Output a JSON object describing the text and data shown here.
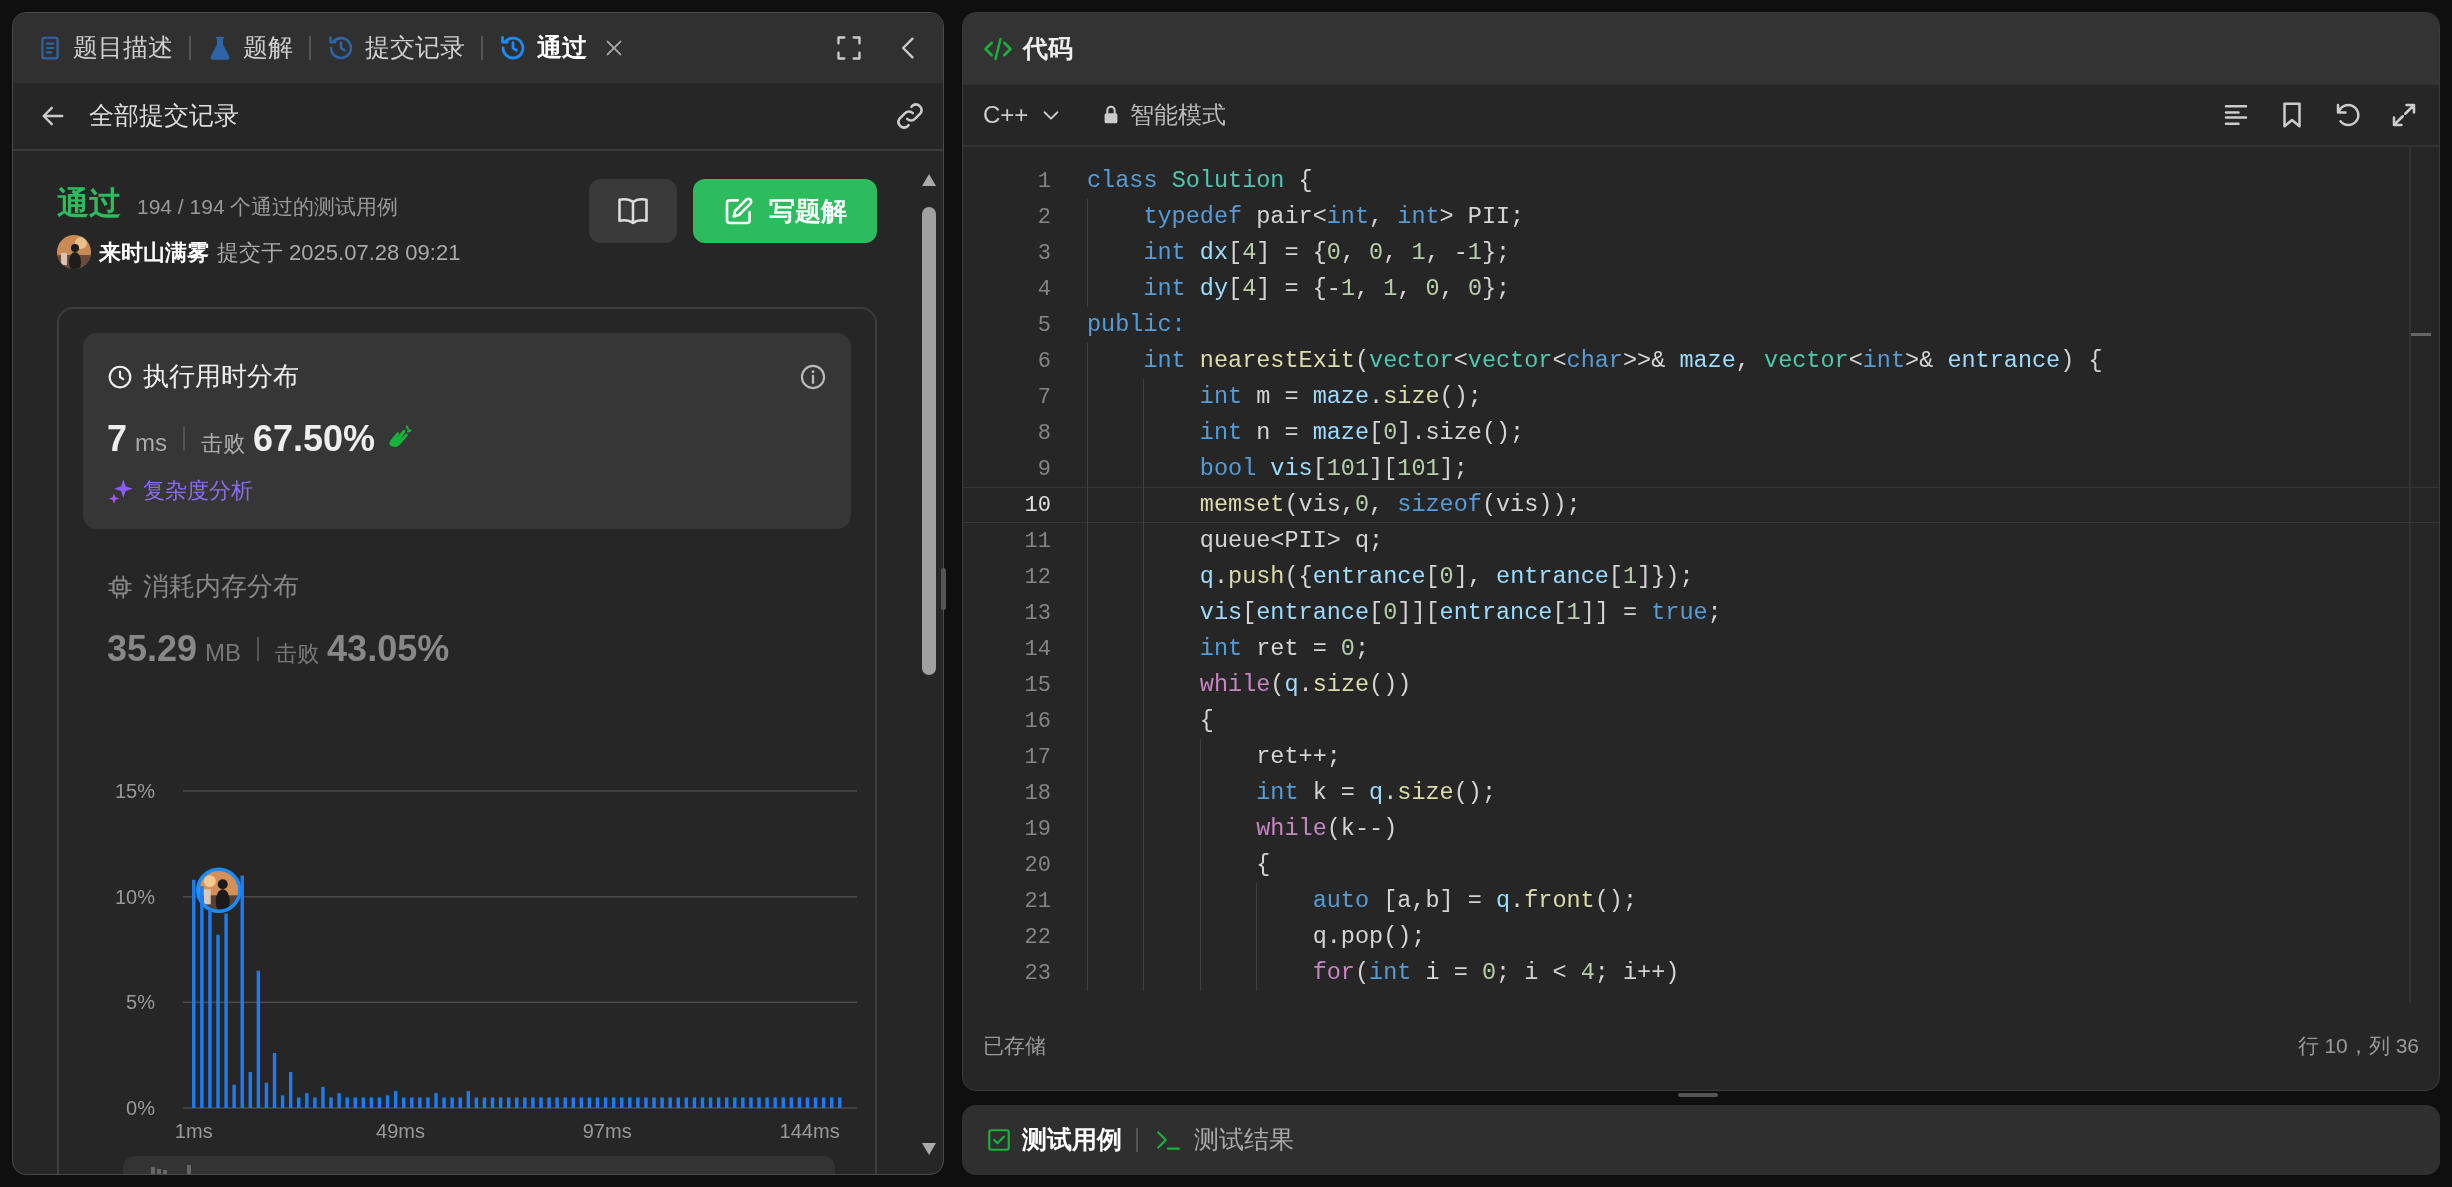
{
  "left_panel": {
    "tabs": [
      {
        "label": "题目描述",
        "selected": false,
        "closable": false
      },
      {
        "label": "题解",
        "selected": false,
        "closable": false
      },
      {
        "label": "提交记录",
        "selected": false,
        "closable": false
      },
      {
        "label": "通过",
        "selected": true,
        "closable": true
      }
    ],
    "subheader": {
      "title": "全部提交记录"
    },
    "submission": {
      "status": "通过",
      "tests": "194 / 194 个通过的测试用例",
      "author": "来时山满雾",
      "submitted": "提交于 2025.07.28 09:21",
      "write_button": "写题解"
    },
    "stats": [
      {
        "title": "执行用时分布",
        "value": "7",
        "unit": "ms",
        "beats_label": "击败",
        "beats": "67.50%",
        "selected": true,
        "analysis": "复杂度分析"
      },
      {
        "title": "消耗内存分布",
        "value": "35.29",
        "unit": "MB",
        "beats_label": "击败",
        "beats": "43.05%",
        "selected": false
      }
    ],
    "chart_data": {
      "type": "bar",
      "xlim": [
        -1.5,
        155
      ],
      "ylim": [
        0,
        15
      ],
      "xticks": [
        {
          "value": 1,
          "label": "1ms"
        },
        {
          "value": 49,
          "label": "49ms"
        },
        {
          "value": 97,
          "label": "97ms"
        },
        {
          "value": 144,
          "label": "144ms"
        }
      ],
      "yticks": [
        {
          "value": 0,
          "label": "0%"
        },
        {
          "value": 5,
          "label": "5%"
        },
        {
          "value": 10,
          "label": "10%"
        },
        {
          "value": 15,
          "label": "15%"
        }
      ],
      "x": [
        1,
        2.875,
        4.75,
        6.625,
        8.5,
        10.375,
        12.25,
        14.125,
        16,
        17.875,
        19.75,
        21.625,
        23.5,
        25.375,
        27.25,
        29.125,
        31,
        32.875,
        34.75,
        36.625,
        38.5,
        40.375,
        42.25,
        44.125,
        46,
        47.875,
        49.75,
        51.625,
        53.5,
        55.375,
        57.25,
        59.125,
        61,
        62.875,
        64.75,
        66.625,
        68.5,
        70.375,
        72.25,
        74.125,
        76,
        77.875,
        79.75,
        81.625,
        83.5,
        85.375,
        87.25,
        89.125,
        91,
        92.875,
        94.75,
        96.625,
        98.5,
        100.375,
        102.25,
        104.125,
        106,
        107.875,
        109.75,
        111.625,
        113.5,
        115.375,
        117.25,
        119.125,
        121,
        122.875,
        124.75,
        126.625,
        128.5,
        130.375,
        132.25,
        134.125,
        136,
        137.875,
        139.75,
        141.625,
        143.5,
        145.375,
        147.25,
        149.125,
        151
      ],
      "series": [
        {
          "color": "#1a7ef2",
          "values": [
            10.8,
            10.5,
            9.4,
            8.2,
            9.2,
            1.1,
            11.0,
            1.7,
            6.5,
            1.2,
            2.6,
            0.6,
            1.7,
            0.5,
            0.7,
            0.5,
            1.0,
            0.5,
            0.7,
            0.5,
            0.5,
            0.5,
            0.5,
            0.5,
            0.6,
            0.8,
            0.5,
            0.5,
            0.5,
            0.5,
            0.7,
            0.5,
            0.5,
            0.5,
            0.8,
            0.5,
            0.5,
            0.5,
            0.5,
            0.5,
            0.5,
            0.5,
            0.5,
            0.5,
            0.5,
            0.5,
            0.5,
            0.5,
            0.5,
            0.5,
            0.5,
            0.5,
            0.5,
            0.5,
            0.5,
            0.5,
            0.5,
            0.5,
            0.5,
            0.5,
            0.5,
            0.5,
            0.5,
            0.5,
            0.5,
            0.5,
            0.5,
            0.5,
            0.5,
            0.5,
            0.5,
            0.5,
            0.5,
            0.5,
            0.5,
            0.5,
            0.5,
            0.5,
            0.5,
            0.5,
            0.5
          ]
        }
      ]
    }
  },
  "code_panel": {
    "title": "代码",
    "language": "C++",
    "mode": "智能模式",
    "lines": [
      {
        "n": "1",
        "current": false,
        "tokens": [
          {
            "kind": "kw",
            "text": "class "
          },
          {
            "kind": "type",
            "text": "Solution"
          },
          {
            "kind": "plain",
            "text": " {"
          }
        ]
      },
      {
        "n": "2",
        "current": false,
        "tokens": [
          {
            "kind": "kw",
            "text": "    typedef"
          },
          {
            "kind": "plain",
            "text": " pair<"
          },
          {
            "kind": "kw",
            "text": "int"
          },
          {
            "kind": "plain",
            "text": ", "
          },
          {
            "kind": "kw",
            "text": "int"
          },
          {
            "kind": "plain",
            "text": "> PII;"
          }
        ]
      },
      {
        "n": "3",
        "current": false,
        "tokens": [
          {
            "kind": "kw",
            "text": "    int "
          },
          {
            "kind": "var",
            "text": "dx"
          },
          {
            "kind": "plain",
            "text": "["
          },
          {
            "kind": "num",
            "text": "4"
          },
          {
            "kind": "plain",
            "text": "] = {"
          },
          {
            "kind": "num",
            "text": "0"
          },
          {
            "kind": "plain",
            "text": ", "
          },
          {
            "kind": "num",
            "text": "0"
          },
          {
            "kind": "plain",
            "text": ", "
          },
          {
            "kind": "num",
            "text": "1"
          },
          {
            "kind": "plain",
            "text": ", -"
          },
          {
            "kind": "num",
            "text": "1"
          },
          {
            "kind": "plain",
            "text": "};"
          }
        ]
      },
      {
        "n": "4",
        "current": false,
        "tokens": [
          {
            "kind": "kw",
            "text": "    int "
          },
          {
            "kind": "var",
            "text": "dy"
          },
          {
            "kind": "plain",
            "text": "["
          },
          {
            "kind": "num",
            "text": "4"
          },
          {
            "kind": "plain",
            "text": "] = {-"
          },
          {
            "kind": "num",
            "text": "1"
          },
          {
            "kind": "plain",
            "text": ", "
          },
          {
            "kind": "num",
            "text": "1"
          },
          {
            "kind": "plain",
            "text": ", "
          },
          {
            "kind": "num",
            "text": "0"
          },
          {
            "kind": "plain",
            "text": ", "
          },
          {
            "kind": "num",
            "text": "0"
          },
          {
            "kind": "plain",
            "text": "};"
          }
        ]
      },
      {
        "n": "5",
        "current": false,
        "tokens": [
          {
            "kind": "kw",
            "text": "public:"
          }
        ]
      },
      {
        "n": "6",
        "current": false,
        "tokens": [
          {
            "kind": "kw",
            "text": "    int "
          },
          {
            "kind": "fn",
            "text": "nearestExit"
          },
          {
            "kind": "plain",
            "text": "("
          },
          {
            "kind": "type",
            "text": "vector"
          },
          {
            "kind": "plain",
            "text": "<"
          },
          {
            "kind": "type",
            "text": "vector"
          },
          {
            "kind": "plain",
            "text": "<"
          },
          {
            "kind": "kw",
            "text": "char"
          },
          {
            "kind": "plain",
            "text": ">>& "
          },
          {
            "kind": "var",
            "text": "maze"
          },
          {
            "kind": "plain",
            "text": ", "
          },
          {
            "kind": "type",
            "text": "vector"
          },
          {
            "kind": "plain",
            "text": "<"
          },
          {
            "kind": "kw",
            "text": "int"
          },
          {
            "kind": "plain",
            "text": ">& "
          },
          {
            "kind": "var",
            "text": "entrance"
          },
          {
            "kind": "plain",
            "text": ") {"
          }
        ]
      },
      {
        "n": "7",
        "current": false,
        "tokens": [
          {
            "kind": "kw",
            "text": "        int"
          },
          {
            "kind": "plain",
            "text": " m = "
          },
          {
            "kind": "var",
            "text": "maze"
          },
          {
            "kind": "plain",
            "text": "."
          },
          {
            "kind": "fn",
            "text": "size"
          },
          {
            "kind": "plain",
            "text": "();"
          }
        ]
      },
      {
        "n": "8",
        "current": false,
        "tokens": [
          {
            "kind": "kw",
            "text": "        int"
          },
          {
            "kind": "plain",
            "text": " n = "
          },
          {
            "kind": "var",
            "text": "maze"
          },
          {
            "kind": "plain",
            "text": "["
          },
          {
            "kind": "num",
            "text": "0"
          },
          {
            "kind": "plain",
            "text": "].size();"
          }
        ]
      },
      {
        "n": "9",
        "current": false,
        "tokens": [
          {
            "kind": "kw",
            "text": "        bool "
          },
          {
            "kind": "var",
            "text": "vis"
          },
          {
            "kind": "plain",
            "text": "["
          },
          {
            "kind": "num",
            "text": "101"
          },
          {
            "kind": "plain",
            "text": "]["
          },
          {
            "kind": "num",
            "text": "101"
          },
          {
            "kind": "plain",
            "text": "];"
          }
        ]
      },
      {
        "n": "10",
        "current": true,
        "tokens": [
          {
            "kind": "fn",
            "text": "        memset"
          },
          {
            "kind": "plain",
            "text": "(vis,"
          },
          {
            "kind": "num",
            "text": "0"
          },
          {
            "kind": "plain",
            "text": ", "
          },
          {
            "kind": "kw",
            "text": "sizeof"
          },
          {
            "kind": "plain",
            "text": "(vis));"
          }
        ]
      },
      {
        "n": "11",
        "current": false,
        "tokens": [
          {
            "kind": "plain",
            "text": "        queue<PII> q;"
          }
        ]
      },
      {
        "n": "12",
        "current": false,
        "tokens": [
          {
            "kind": "var",
            "text": "        q"
          },
          {
            "kind": "plain",
            "text": "."
          },
          {
            "kind": "fn",
            "text": "push"
          },
          {
            "kind": "plain",
            "text": "({"
          },
          {
            "kind": "var",
            "text": "entrance"
          },
          {
            "kind": "plain",
            "text": "["
          },
          {
            "kind": "num",
            "text": "0"
          },
          {
            "kind": "plain",
            "text": "], "
          },
          {
            "kind": "var",
            "text": "entrance"
          },
          {
            "kind": "plain",
            "text": "["
          },
          {
            "kind": "num",
            "text": "1"
          },
          {
            "kind": "plain",
            "text": "]});"
          }
        ]
      },
      {
        "n": "13",
        "current": false,
        "tokens": [
          {
            "kind": "var",
            "text": "        vis"
          },
          {
            "kind": "plain",
            "text": "["
          },
          {
            "kind": "var",
            "text": "entrance"
          },
          {
            "kind": "plain",
            "text": "["
          },
          {
            "kind": "num",
            "text": "0"
          },
          {
            "kind": "plain",
            "text": "]]["
          },
          {
            "kind": "var",
            "text": "entrance"
          },
          {
            "kind": "plain",
            "text": "["
          },
          {
            "kind": "num",
            "text": "1"
          },
          {
            "kind": "plain",
            "text": "]] = "
          },
          {
            "kind": "kw",
            "text": "true"
          },
          {
            "kind": "plain",
            "text": ";"
          }
        ]
      },
      {
        "n": "14",
        "current": false,
        "tokens": [
          {
            "kind": "kw",
            "text": "        int"
          },
          {
            "kind": "plain",
            "text": " ret = "
          },
          {
            "kind": "num",
            "text": "0"
          },
          {
            "kind": "plain",
            "text": ";"
          }
        ]
      },
      {
        "n": "15",
        "current": false,
        "tokens": [
          {
            "kind": "ctrl",
            "text": "        while"
          },
          {
            "kind": "plain",
            "text": "("
          },
          {
            "kind": "var",
            "text": "q"
          },
          {
            "kind": "plain",
            "text": "."
          },
          {
            "kind": "fn",
            "text": "size"
          },
          {
            "kind": "plain",
            "text": "())"
          }
        ]
      },
      {
        "n": "16",
        "current": false,
        "tokens": [
          {
            "kind": "plain",
            "text": "        {"
          }
        ]
      },
      {
        "n": "17",
        "current": false,
        "tokens": [
          {
            "kind": "plain",
            "text": "            ret++;"
          }
        ]
      },
      {
        "n": "18",
        "current": false,
        "tokens": [
          {
            "kind": "kw",
            "text": "            int"
          },
          {
            "kind": "plain",
            "text": " k = "
          },
          {
            "kind": "var",
            "text": "q"
          },
          {
            "kind": "plain",
            "text": "."
          },
          {
            "kind": "fn",
            "text": "size"
          },
          {
            "kind": "plain",
            "text": "();"
          }
        ]
      },
      {
        "n": "19",
        "current": false,
        "tokens": [
          {
            "kind": "ctrl",
            "text": "            while"
          },
          {
            "kind": "plain",
            "text": "(k--)"
          }
        ]
      },
      {
        "n": "20",
        "current": false,
        "tokens": [
          {
            "kind": "plain",
            "text": "            {"
          }
        ]
      },
      {
        "n": "21",
        "current": false,
        "tokens": [
          {
            "kind": "kw",
            "text": "                auto"
          },
          {
            "kind": "plain",
            "text": " [a,b] = "
          },
          {
            "kind": "var",
            "text": "q"
          },
          {
            "kind": "plain",
            "text": "."
          },
          {
            "kind": "fn",
            "text": "front"
          },
          {
            "kind": "plain",
            "text": "();"
          }
        ]
      },
      {
        "n": "22",
        "current": false,
        "tokens": [
          {
            "kind": "plain",
            "text": "                q.pop();"
          }
        ]
      },
      {
        "n": "23",
        "current": false,
        "tokens": [
          {
            "kind": "ctrl",
            "text": "                for"
          },
          {
            "kind": "plain",
            "text": "("
          },
          {
            "kind": "kw",
            "text": "int"
          },
          {
            "kind": "plain",
            "text": " i = "
          },
          {
            "kind": "num",
            "text": "0"
          },
          {
            "kind": "plain",
            "text": "; i < "
          },
          {
            "kind": "num",
            "text": "4"
          },
          {
            "kind": "plain",
            "text": "; i++)"
          }
        ]
      }
    ],
    "save_status": "已存储",
    "cursor": "行 10，列 36"
  },
  "bottom_tabs": [
    {
      "label": "测试用例",
      "selected": true
    },
    {
      "label": "测试结果",
      "selected": false
    }
  ]
}
